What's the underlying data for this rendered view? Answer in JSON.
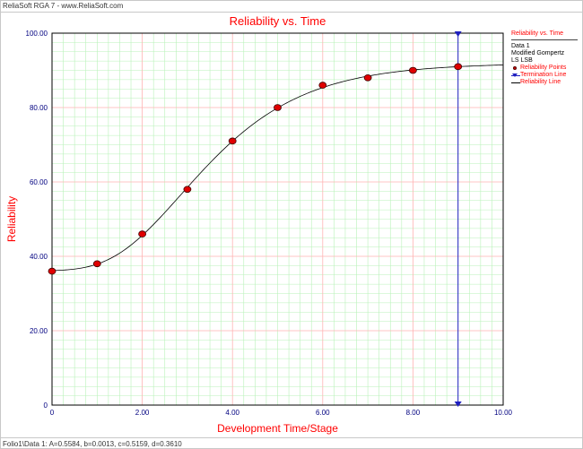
{
  "window": {
    "title": "ReliaSoft RGA 7 - www.ReliaSoft.com",
    "status": "Folio1\\Data 1: A=0.5584, b=0.0013, c=0.5159, d=0.3610"
  },
  "legend": {
    "title": "Reliability vs. Time",
    "data_name": "Data 1",
    "model": "Modified Gompertz",
    "method": "LS LSB",
    "items": [
      {
        "symbol": "dot",
        "label": "Reliability Points"
      },
      {
        "symbol": "triangle",
        "label": "Termination Line"
      },
      {
        "symbol": "line",
        "label": "Reliability Line"
      }
    ]
  },
  "colors": {
    "title": "#ff0000",
    "tick_labels": "#000080",
    "axis_labels": "#ff0000",
    "points": "#e00000",
    "curve": "#000000",
    "termination": "#1f1fc0",
    "major_grid": "#ffb3b3",
    "minor_grid": "#b9f2b9"
  },
  "chart_data": {
    "type": "scatter",
    "title": "Reliability vs. Time",
    "xlabel": "Development Time/Stage",
    "ylabel": "Reliability",
    "xlim": [
      0,
      10
    ],
    "ylim": [
      0,
      100
    ],
    "xticks": [
      0,
      2,
      4,
      6,
      8,
      10
    ],
    "xtick_labels": [
      "0",
      "2.00",
      "4.00",
      "6.00",
      "8.00",
      "10.00"
    ],
    "yticks": [
      0,
      20,
      40,
      60,
      80,
      100
    ],
    "ytick_labels": [
      "0",
      "20.00",
      "40.00",
      "60.00",
      "80.00",
      "100.00"
    ],
    "grid": true,
    "legend_position": "right",
    "series": [
      {
        "name": "Reliability Points",
        "type": "scatter",
        "x": [
          0,
          1,
          2,
          3,
          4,
          5,
          6,
          7,
          8,
          9
        ],
        "y": [
          36,
          38,
          46,
          58,
          71,
          80,
          86,
          88,
          90,
          91
        ]
      },
      {
        "name": "Reliability Line",
        "type": "line",
        "model": "Modified Gompertz",
        "parameters": {
          "A": 0.5584,
          "b": 0.0013,
          "c": 0.5159,
          "d": 0.361
        }
      },
      {
        "name": "Termination Line",
        "type": "vertical-line",
        "x": 9
      }
    ]
  }
}
